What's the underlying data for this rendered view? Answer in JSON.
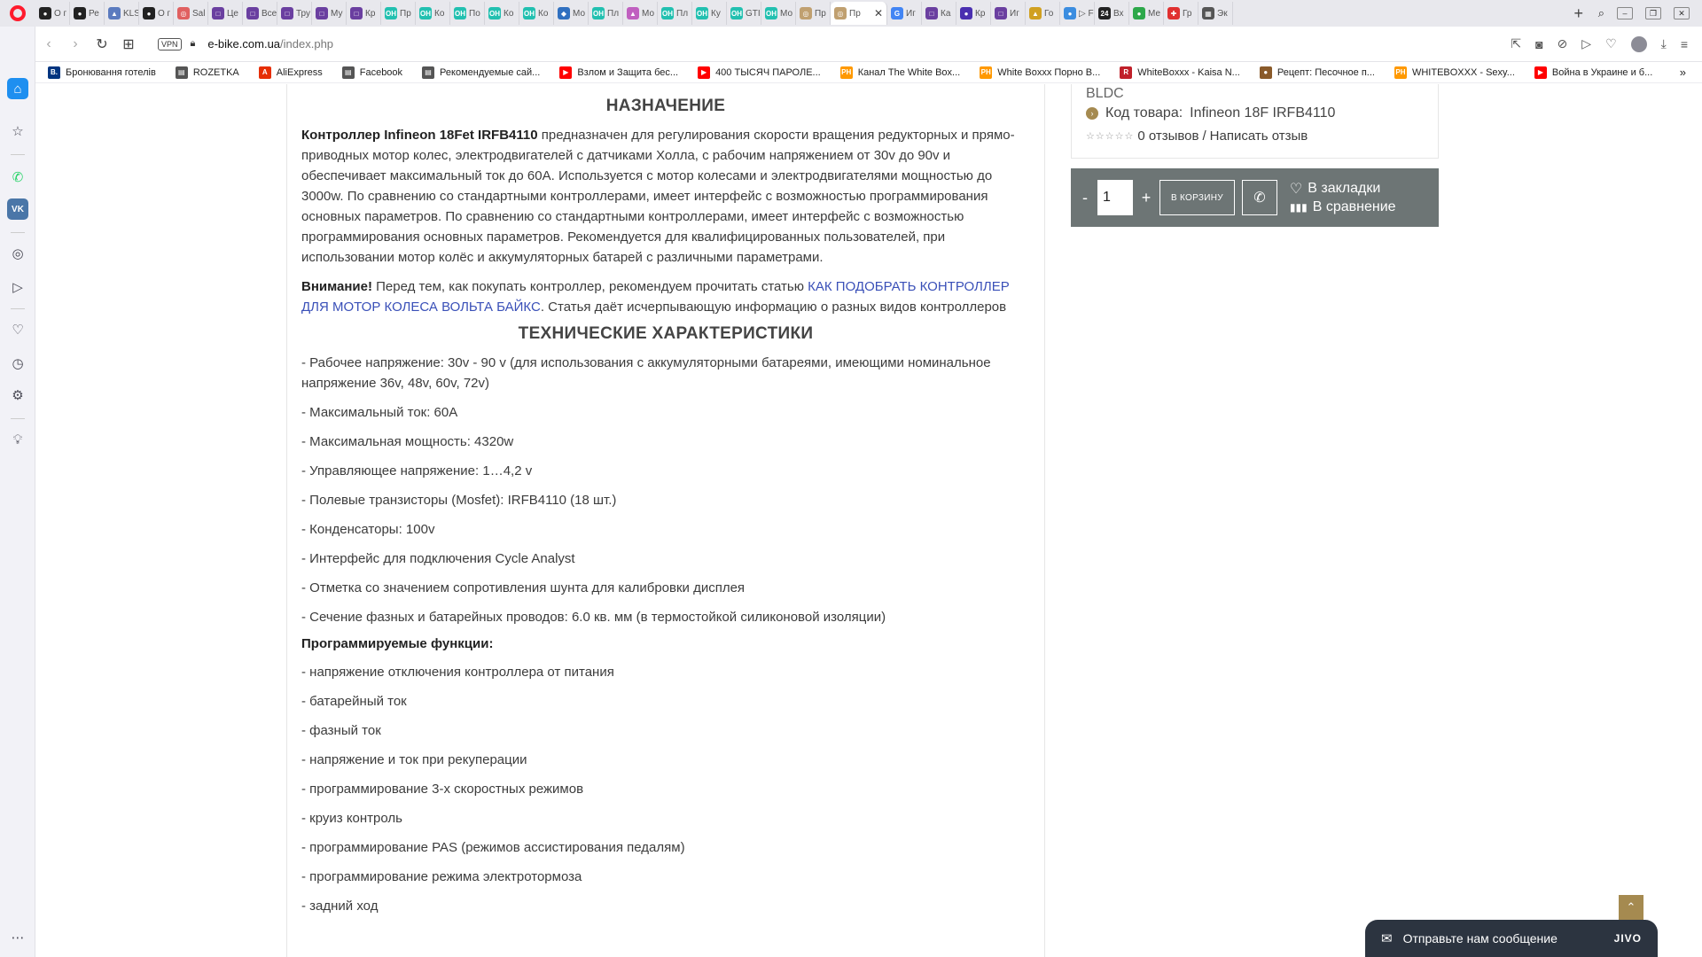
{
  "browser": {
    "tabs": [
      {
        "label": "О г",
        "color": "#222",
        "glyph": "●"
      },
      {
        "label": "Ре",
        "color": "#222",
        "glyph": "●"
      },
      {
        "label": "KLS",
        "color": "#5b7bbf",
        "glyph": "▲"
      },
      {
        "label": "О г",
        "color": "#222",
        "glyph": "●"
      },
      {
        "label": "Sal",
        "color": "#e06060",
        "glyph": "◎"
      },
      {
        "label": "Це",
        "color": "#6a3fa0",
        "glyph": "□"
      },
      {
        "label": "Все",
        "color": "#6a3fa0",
        "glyph": "□"
      },
      {
        "label": "Тру",
        "color": "#6a3fa0",
        "glyph": "□"
      },
      {
        "label": "Му",
        "color": "#6a3fa0",
        "glyph": "□"
      },
      {
        "label": "Кр",
        "color": "#6a3fa0",
        "glyph": "□"
      },
      {
        "label": "Пр",
        "color": "#22c0b0",
        "glyph": "OH"
      },
      {
        "label": "Ко",
        "color": "#22c0b0",
        "glyph": "OH"
      },
      {
        "label": "По",
        "color": "#22c0b0",
        "glyph": "OH"
      },
      {
        "label": "Ко",
        "color": "#22c0b0",
        "glyph": "OH"
      },
      {
        "label": "Ко",
        "color": "#22c0b0",
        "glyph": "OH"
      },
      {
        "label": "Мо",
        "color": "#3070c0",
        "glyph": "◆"
      },
      {
        "label": "Пл",
        "color": "#22c0b0",
        "glyph": "OH"
      },
      {
        "label": "Мо",
        "color": "#c060c0",
        "glyph": "▲"
      },
      {
        "label": "Пл",
        "color": "#22c0b0",
        "glyph": "OH"
      },
      {
        "label": "Ку",
        "color": "#22c0b0",
        "glyph": "OH"
      },
      {
        "label": "GTI",
        "color": "#22c0b0",
        "glyph": "OH"
      },
      {
        "label": "Мо",
        "color": "#22c0b0",
        "glyph": "OH"
      },
      {
        "label": "Пр",
        "color": "#c0a070",
        "glyph": "◎"
      },
      {
        "label": "Пр",
        "color": "#c0a070",
        "glyph": "◎",
        "active": true
      },
      {
        "label": "Иг",
        "color": "#4285f4",
        "glyph": "G"
      },
      {
        "label": "Ка",
        "color": "#6a3fa0",
        "glyph": "□"
      },
      {
        "label": "Кр",
        "color": "#4a2fb0",
        "glyph": "●"
      },
      {
        "label": "Иг",
        "color": "#6a3fa0",
        "glyph": "□"
      },
      {
        "label": "Го",
        "color": "#d0a020",
        "glyph": "▲"
      },
      {
        "label": "▷ F",
        "color": "#3b8de0",
        "glyph": "●"
      },
      {
        "label": "Вх",
        "color": "#222",
        "glyph": "24"
      },
      {
        "label": "Ме",
        "color": "#2da84a",
        "glyph": "●"
      },
      {
        "label": "Гр",
        "color": "#e03030",
        "glyph": "✚"
      },
      {
        "label": "Эк",
        "color": "#555",
        "glyph": "▦"
      }
    ],
    "url_host": "e-bike.com.ua",
    "url_path": "/index.php",
    "vpn_label": "VPN",
    "bookmarks": [
      {
        "label": "Бронювання готелів",
        "icon": "B.",
        "color": "#003580"
      },
      {
        "label": "ROZETKA",
        "icon": "▤",
        "color": "#555"
      },
      {
        "label": "AliExpress",
        "icon": "A",
        "color": "#e62e04"
      },
      {
        "label": "Facebook",
        "icon": "▤",
        "color": "#555"
      },
      {
        "label": "Рекомендуемые сай...",
        "icon": "▤",
        "color": "#555"
      },
      {
        "label": "Взлом и Защита бес...",
        "icon": "▶",
        "color": "#ff0000"
      },
      {
        "label": "400 ТЫСЯЧ ПАРОЛЕ...",
        "icon": "▶",
        "color": "#ff0000"
      },
      {
        "label": "Канал The White Box...",
        "icon": "PH",
        "color": "#f90"
      },
      {
        "label": "White Boxxx Порно В...",
        "icon": "PH",
        "color": "#f90"
      },
      {
        "label": "WhiteBoxxx - Kaisa N...",
        "icon": "R",
        "color": "#c0202a"
      },
      {
        "label": "Рецепт: Песочное п...",
        "icon": "●",
        "color": "#8a5a2a"
      },
      {
        "label": "WHITEBOXXX - Sexy...",
        "icon": "PH",
        "color": "#f90"
      },
      {
        "label": "Война в Украине и б...",
        "icon": "▶",
        "color": "#ff0000"
      }
    ],
    "bookmarks_more": "»"
  },
  "product": {
    "bldc": "BLDC",
    "sku_label": "Код товара:",
    "sku_value": "Infineon 18F IRFB4110",
    "rating_stars": "☆☆☆☆☆",
    "reviews": "0 отзывов",
    "review_sep": "/",
    "write_review": "Написать отзыв",
    "qty_minus": "-",
    "qty_value": "1",
    "qty_plus": "+",
    "cart_button": "В КОРЗИНУ",
    "bookmark_label": "В закладки",
    "compare_label": "В сравнение"
  },
  "content": {
    "purpose_heading": "НАЗНАЧЕНИЕ",
    "purpose_bold": "Контроллер Infineon 18Fet IRFB4110",
    "purpose_text": " предназначен для  регулирования скорости вращения редукторных и прямо-приводных мотор колес,  электродвигателей с датчиками Холла, с рабочим напряжением от 30v до 90v и обеспечивает максимальный ток до 60А. Используется с мотор колесами и электродвигателями мощностью до 3000w. По сравнению со стандартными контроллерами, имеет интерфейс с возможностью программирования основных параметров. По сравнению со стандартными контроллерами, имеет интерфейс с возможностью программирования основных параметров. Рекомендуется для квалифицированных пользователей, при использовании мотор колёс и аккумуляторных батарей с различными параметрами.",
    "warning_bold": "Внимание!",
    "warning_text": " Перед тем, как покупать контроллер, рекомендуем прочитать статью ",
    "warning_link": "КАК ПОДОБРАТЬ КОНТРОЛЛЕР ДЛЯ МОТОР КОЛЕСА ВОЛЬТА БАЙКС",
    "warning_tail": ". Статья даёт исчерпывающую информацию о разных видов контроллеров",
    "specs_heading": "ТЕХНИЧЕСКИЕ ХАРАКТЕРИСТИКИ",
    "specs": [
      "- Рабочее напряжение: 30v - 90 v (для использования с аккумуляторными батареями, имеющими номинальное напряжение 36v, 48v, 60v, 72v)",
      "- Максимальный ток: 60А",
      "- Максимальная мощность: 4320w",
      "- Управляющее напряжение: 1…4,2 v",
      "- Полевые транзисторы (Mosfet): IRFB4110 (18 шт.)",
      "- Конденсаторы: 100v",
      "- Интерфейс для подключения Cycle Analyst",
      "- Отметка со значением сопротивления шунта для калибровки дисплея",
      "- Сечение фазных и батарейных проводов: 6.0 кв. мм (в термостойкой силиконовой изоляции)"
    ],
    "prog_heading": "Программируемые функции:",
    "functions": [
      "- напряжение отключения контроллера от питания",
      "- батарейный ток",
      "- фазный ток",
      "- напряжение и ток при рекуперации",
      "- программирование 3-х скоростных режимов",
      "- круиз контроль",
      "- программирование PAS (режимов ассистирования педалям)",
      "- программирование режима электротормоза",
      "- задний ход"
    ]
  },
  "chat": {
    "text": "Отправьте нам сообщение",
    "logo": "JIVO"
  }
}
